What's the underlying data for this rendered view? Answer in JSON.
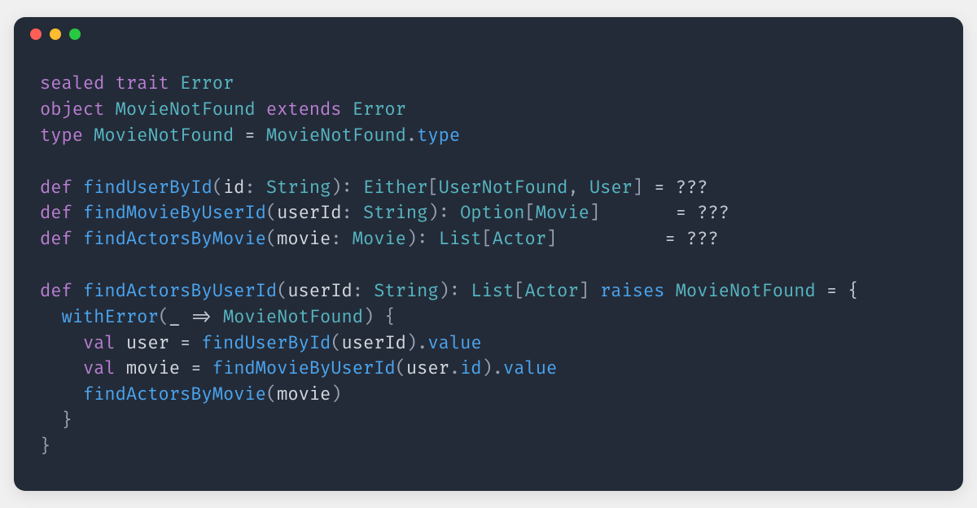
{
  "titlebar": {
    "close_icon": "●",
    "minimize_icon": "●",
    "maximize_icon": "●"
  },
  "code": {
    "line1": {
      "t1": "sealed",
      "t2": "trait",
      "t3": "Error"
    },
    "line2": {
      "t1": "object",
      "t2": "MovieNotFound",
      "t3": "extends",
      "t4": "Error"
    },
    "line3": {
      "t1": "type",
      "t2": "MovieNotFound",
      "t3": "=",
      "t4": "MovieNotFound",
      "t5": ".",
      "t6": "type"
    },
    "line4": "",
    "line5": {
      "t1": "def",
      "t2": "findUserById",
      "t3": "(",
      "t4": "id",
      "t5": ":",
      "t6": "String",
      "t7": "):",
      "t8": "Either",
      "t9": "[",
      "t10": "UserNotFound",
      "t11": ",",
      "t12": "User",
      "t13": "]",
      "t14": "= ???"
    },
    "line6": {
      "t1": "def",
      "t2": "findMovieByUserId",
      "t3": "(",
      "t4": "userId",
      "t5": ":",
      "t6": "String",
      "t7": "):",
      "t8": "Option",
      "t9": "[",
      "t10": "Movie",
      "t11": "]      ",
      "t12": "= ???"
    },
    "line7": {
      "t1": "def",
      "t2": "findActorsByMovie",
      "t3": "(",
      "t4": "movie",
      "t5": ":",
      "t6": "Movie",
      "t7": "):",
      "t8": "List",
      "t9": "[",
      "t10": "Actor",
      "t11": "]         ",
      "t12": "= ???"
    },
    "line8": "",
    "line9": {
      "t1": "def",
      "t2": "findActorsByUserId",
      "t3": "(",
      "t4": "userId",
      "t5": ":",
      "t6": "String",
      "t7": "):",
      "t8": "List",
      "t9": "[",
      "t10": "Actor",
      "t11": "]",
      "t12": "raises",
      "t13": "MovieNotFound",
      "t14": "= {"
    },
    "line10": {
      "indent": "  ",
      "t1": "withError",
      "t2": "(",
      "t3": "_",
      "t4": "=>",
      "t5": "MovieNotFound",
      "t6": ") {"
    },
    "line11": {
      "indent": "    ",
      "t1": "val",
      "t2": "user",
      "t3": "=",
      "t4": "findUserById",
      "t5": "(",
      "t6": "userId",
      "t7": ").",
      "t8": "value"
    },
    "line12": {
      "indent": "    ",
      "t1": "val",
      "t2": "movie",
      "t3": "=",
      "t4": "findMovieByUserId",
      "t5": "(",
      "t6": "user",
      "t7": ".",
      "t8": "id",
      "t9": ").",
      "t10": "value"
    },
    "line13": {
      "indent": "    ",
      "t1": "findActorsByMovie",
      "t2": "(",
      "t3": "movie",
      "t4": ")"
    },
    "line14": {
      "indent": "  ",
      "t1": "}"
    },
    "line15": {
      "t1": "}"
    }
  }
}
